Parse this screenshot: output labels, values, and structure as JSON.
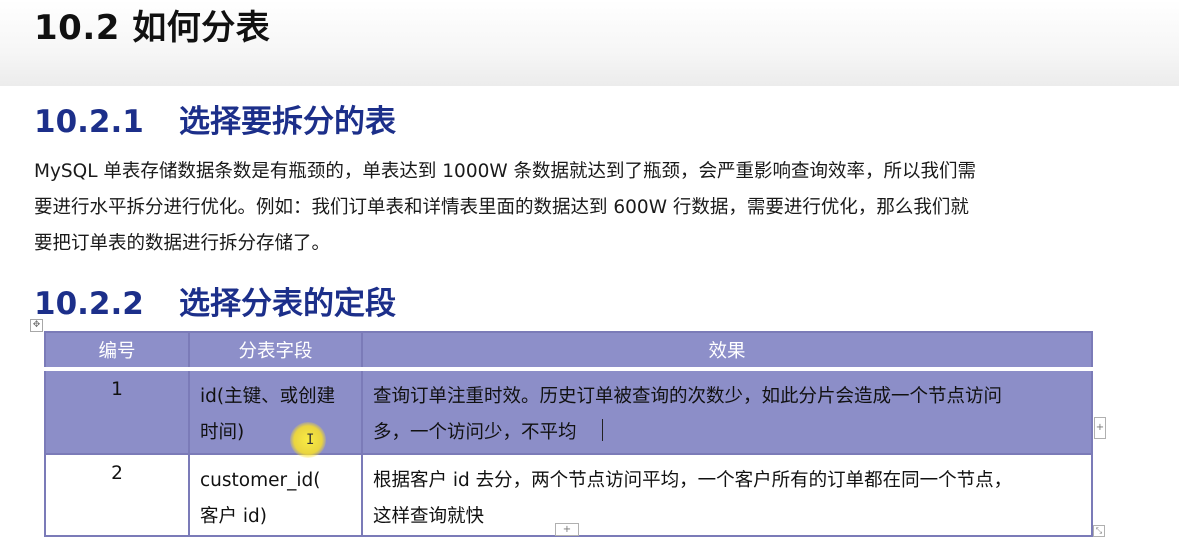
{
  "page_title": "10.2  如何分表",
  "sections": [
    {
      "number": "10.2.1",
      "title": "选择要拆分的表"
    },
    {
      "number": "10.2.2",
      "title": "选择分表的定段"
    }
  ],
  "paragraph_lines": [
    "MySQL 单表存储数据条数是有瓶颈的，单表达到 1000W 条数据就达到了瓶颈，会严重影响查询效率，所以我们需",
    "要进行水平拆分进行优化。例如：我们订单表和详情表里面的数据达到 600W 行数据，需要进行优化，那么我们就",
    "要把订单表的数据进行拆分存储了。"
  ],
  "table": {
    "headers": [
      "编号",
      "分表字段",
      "效果"
    ],
    "rows": [
      {
        "num": "1",
        "field_lines": [
          "id(主键、或创建",
          "时间)"
        ],
        "effect_lines": [
          "查询订单注重时效。历史订单被查询的次数少，如此分片会造成一个节点访问",
          "多，一个访问少，不平均"
        ]
      },
      {
        "num": "2",
        "field_lines": [
          "customer_id(",
          "客户 id)"
        ],
        "effect_lines": [
          "根据客户 id 去分，两个节点访问平均，一个客户所有的订单都在同一个节点，",
          "这样查询就快"
        ]
      }
    ]
  },
  "icons": {
    "table_move": "move-handle-icon",
    "text_cursor": "i-beam-cursor-icon",
    "add_column": "plus-icon",
    "add_row": "plus-icon",
    "resize": "resize-corner-icon"
  },
  "colors": {
    "heading_blue": "#1c2f8a",
    "table_header_bg": "#8d8fc9",
    "selected_row_bg": "#8c8ec8",
    "table_border": "#7b7bb8",
    "cursor_highlight": "#f5e12a"
  }
}
